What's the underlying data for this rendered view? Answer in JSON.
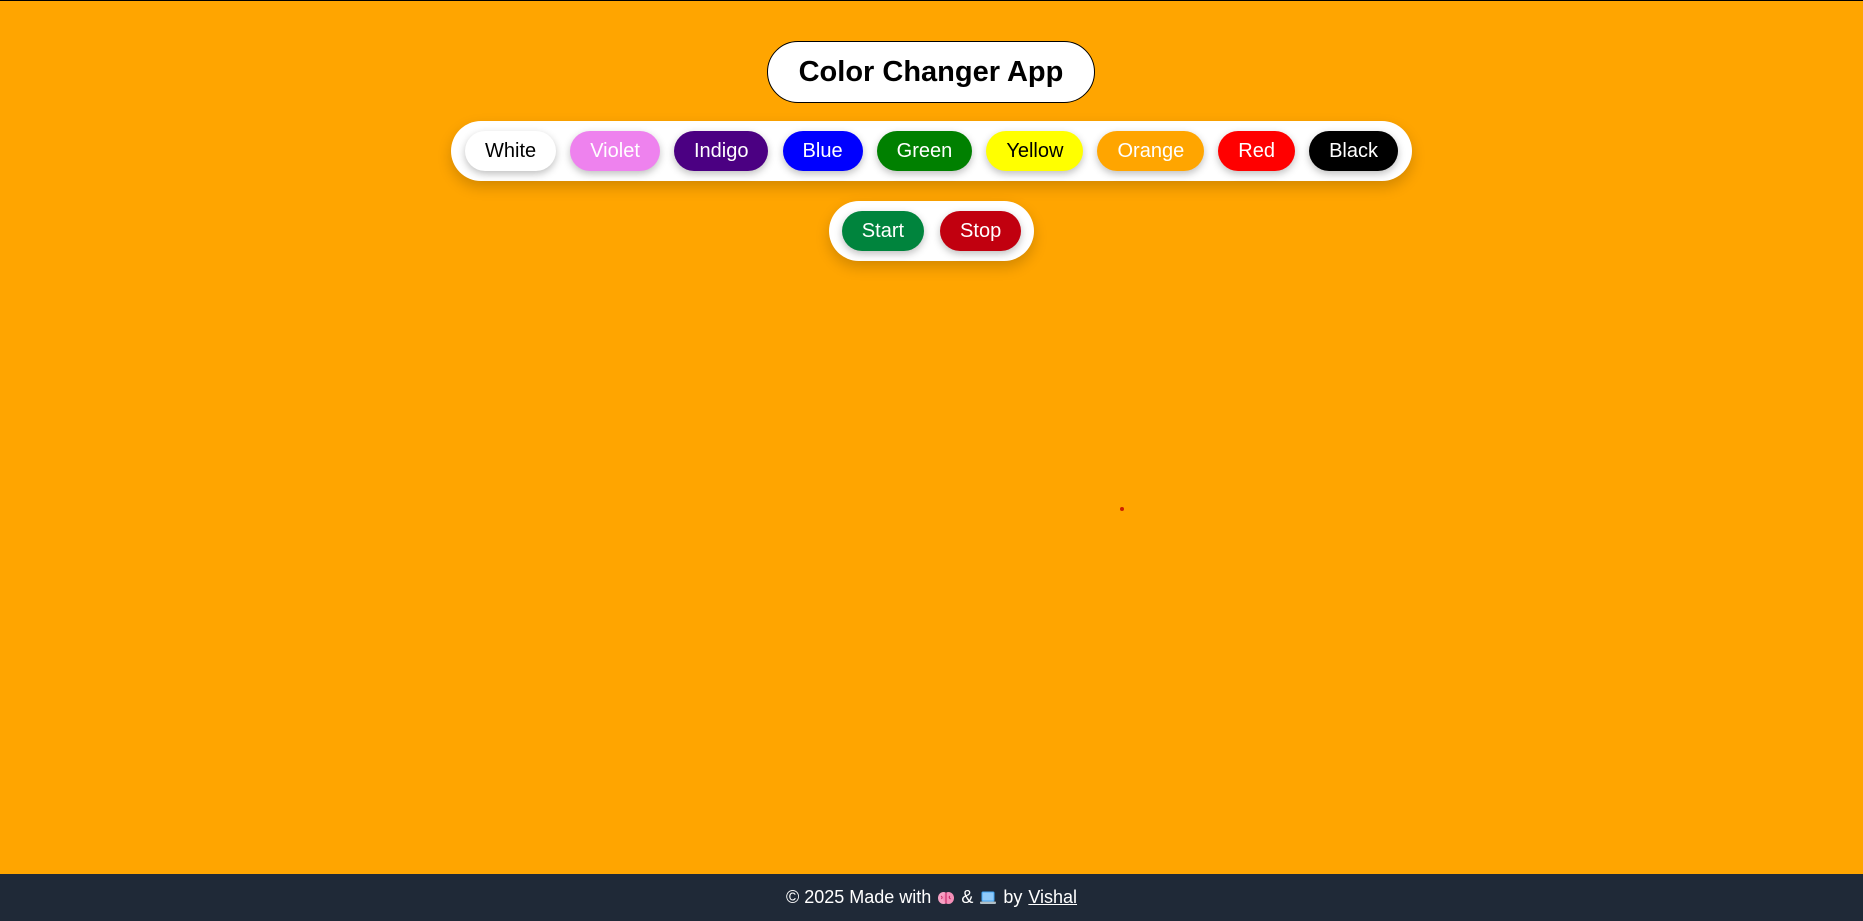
{
  "app": {
    "title": "Color Changer App",
    "background_color": "#FFA500"
  },
  "color_buttons": [
    {
      "label": "White",
      "bg": "#FFFFFF",
      "fg": "#000000"
    },
    {
      "label": "Violet",
      "bg": "#EE82EE",
      "fg": "#FFFFFF"
    },
    {
      "label": "Indigo",
      "bg": "#4B0082",
      "fg": "#FFFFFF"
    },
    {
      "label": "Blue",
      "bg": "#0000FF",
      "fg": "#FFFFFF"
    },
    {
      "label": "Green",
      "bg": "#008000",
      "fg": "#FFFFFF"
    },
    {
      "label": "Yellow",
      "bg": "#FFFF00",
      "fg": "#000000"
    },
    {
      "label": "Orange",
      "bg": "#FFA500",
      "fg": "#FFFFFF"
    },
    {
      "label": "Red",
      "bg": "#FF0000",
      "fg": "#FFFFFF"
    },
    {
      "label": "Black",
      "bg": "#000000",
      "fg": "#FFFFFF"
    }
  ],
  "controls": {
    "start_label": "Start",
    "start_color": "#00843D",
    "stop_label": "Stop",
    "stop_color": "#C1000F"
  },
  "dot_color": "#CC2200",
  "footer": {
    "prefix": "© 2025 Made with",
    "brain_icon": "brain-icon",
    "ampersand": "&",
    "laptop_icon": "laptop-icon",
    "by": "by",
    "author": "Vishal"
  }
}
